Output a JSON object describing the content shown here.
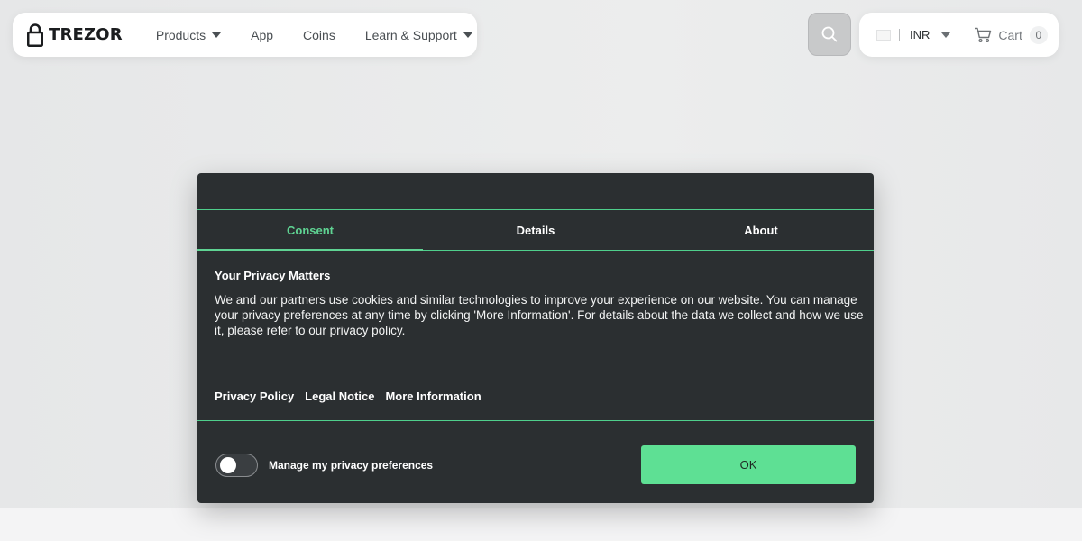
{
  "header": {
    "logo_text": "TREZOR",
    "nav": [
      {
        "label": "Products",
        "has_dropdown": true
      },
      {
        "label": "App",
        "has_dropdown": false
      },
      {
        "label": "Coins",
        "has_dropdown": false
      },
      {
        "label": "Learn & Support",
        "has_dropdown": true
      }
    ],
    "search_icon": "search-icon",
    "currency": "INR",
    "cart_label": "Cart",
    "cart_count": "0"
  },
  "consent_modal": {
    "tabs": [
      {
        "label": "Consent",
        "active": true
      },
      {
        "label": "Details",
        "active": false
      },
      {
        "label": "About",
        "active": false
      }
    ],
    "title": "Your Privacy Matters",
    "body": "We and our partners use cookies and similar technologies to improve your experience on our website. You can manage your privacy preferences at any time by clicking 'More Information'. For details about the data we collect and how we use it, please refer to our privacy policy.",
    "links": [
      "Privacy Policy",
      "Legal Notice",
      "More Information"
    ],
    "toggle_label": "Manage my privacy preferences",
    "toggle_on": false,
    "ok_label": "OK",
    "accent_color": "#5ee094"
  }
}
